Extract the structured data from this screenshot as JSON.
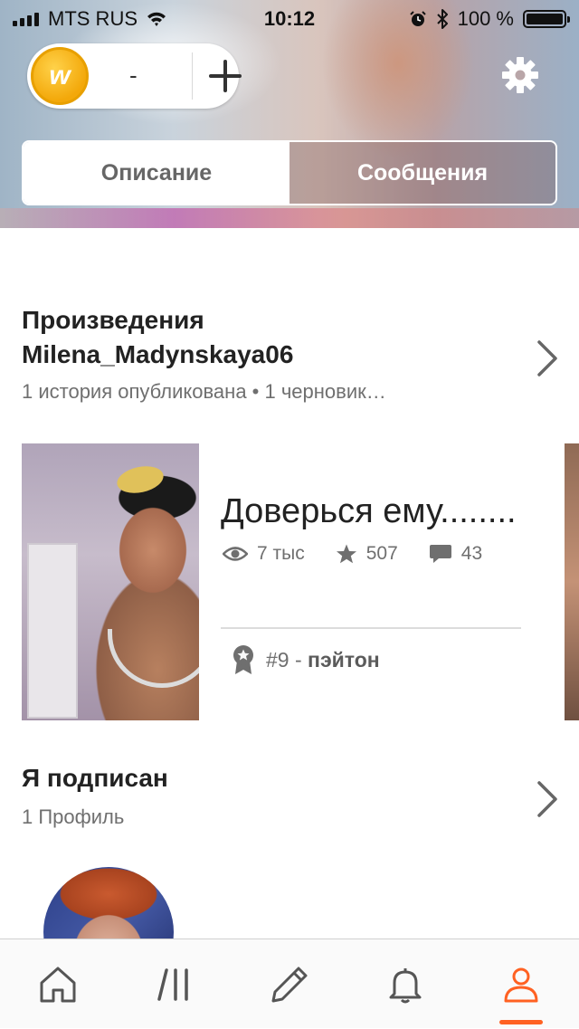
{
  "status_bar": {
    "carrier": "MTS RUS",
    "time": "10:12",
    "battery": "100 %",
    "battery_level": 1.0
  },
  "coins": {
    "icon_letter": "w",
    "count": "-",
    "add_icon": "plus-icon"
  },
  "settings": {
    "icon": "gear-icon"
  },
  "tabs": [
    {
      "label": "Описание",
      "active": true
    },
    {
      "label": "Сообщения",
      "active": false
    }
  ],
  "works": {
    "title": "Произведения",
    "username": "Milena_Madynskaya06",
    "meta": "1 история опубликована • 1 черновик…",
    "story": {
      "title": "Доверься ему........",
      "reads": "7 тыс",
      "votes": "507",
      "comments": "43",
      "rank_num": "#9",
      "rank_sep": " - ",
      "rank_tag": "пэйтон"
    }
  },
  "following": {
    "title": "Я подписан",
    "meta": "1 Профиль"
  },
  "bottom_nav": [
    {
      "name": "home",
      "icon": "home-icon"
    },
    {
      "name": "library",
      "icon": "library-icon"
    },
    {
      "name": "write",
      "icon": "pencil-icon"
    },
    {
      "name": "notifications",
      "icon": "bell-icon"
    },
    {
      "name": "profile",
      "icon": "person-icon",
      "active": true
    }
  ],
  "colors": {
    "accent": "#ff6122",
    "coin": "#f3a80a",
    "text_primary": "#222222",
    "text_secondary": "#6f6f6f"
  }
}
